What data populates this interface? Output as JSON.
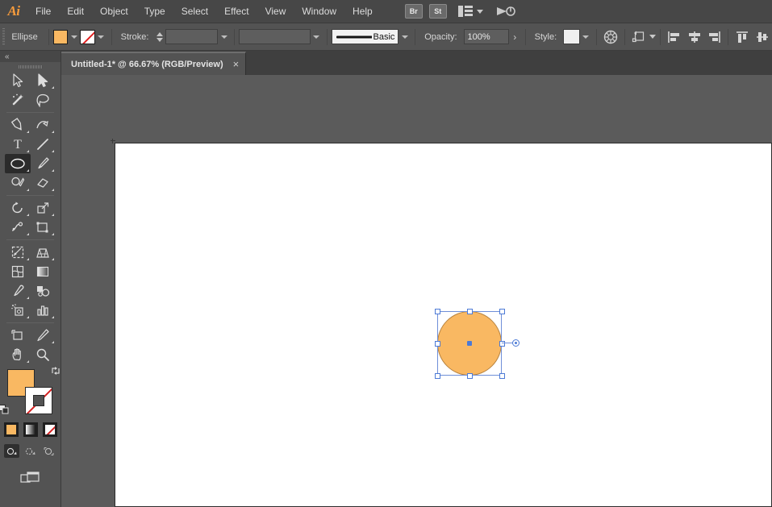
{
  "app": {
    "name": "Adobe Illustrator",
    "logo_text": "Ai"
  },
  "menubar": {
    "items": [
      {
        "label": "File"
      },
      {
        "label": "Edit"
      },
      {
        "label": "Object"
      },
      {
        "label": "Type"
      },
      {
        "label": "Select"
      },
      {
        "label": "Effect"
      },
      {
        "label": "View"
      },
      {
        "label": "Window"
      },
      {
        "label": "Help"
      }
    ],
    "bridge_label": "Br",
    "stock_label": "St",
    "arrange_documents_icon": "arrange-documents-icon",
    "workspace_switcher_icon": "workspace-switcher-icon"
  },
  "controlbar": {
    "selection_label": "Ellipse",
    "fill_label": "Fill",
    "fill_color": "#F9B862",
    "stroke_label": "Stroke:",
    "stroke_color": "none",
    "stroke_weight": "",
    "stroke_profile": "",
    "brush_definition": "Basic",
    "opacity_label": "Opacity:",
    "opacity_value": "100%",
    "style_label": "Style:",
    "style_swatch_color": "#F0F0F0",
    "recolor_artwork_icon": "recolor-artwork-icon",
    "transform_icon": "transform-icon",
    "align_buttons": [
      {
        "name": "align-left-icon"
      },
      {
        "name": "align-horizontal-center-icon"
      },
      {
        "name": "align-right-icon"
      },
      {
        "name": "align-top-icon"
      },
      {
        "name": "align-vertical-center-icon"
      }
    ]
  },
  "tabbar": {
    "document_tab": {
      "title": "Untitled-1* @ 66.67% (RGB/Preview)",
      "close_label": "×"
    }
  },
  "toolpanel": {
    "collapse_label": "«",
    "tools": [
      {
        "name": "selection-tool",
        "label": "Selection Tool",
        "selected": false,
        "has_flyout": false
      },
      {
        "name": "direct-selection-tool",
        "label": "Direct Selection Tool",
        "selected": false,
        "has_flyout": true
      },
      {
        "name": "magic-wand-tool",
        "label": "Magic Wand Tool",
        "selected": false,
        "has_flyout": false
      },
      {
        "name": "lasso-tool",
        "label": "Lasso Tool",
        "selected": false,
        "has_flyout": false
      },
      {
        "name": "pen-tool",
        "label": "Pen Tool",
        "selected": false,
        "has_flyout": true
      },
      {
        "name": "curvature-tool",
        "label": "Curvature Tool",
        "selected": false,
        "has_flyout": true
      },
      {
        "name": "type-tool",
        "label": "Type Tool",
        "selected": false,
        "has_flyout": true
      },
      {
        "name": "line-segment-tool",
        "label": "Line Segment Tool",
        "selected": false,
        "has_flyout": true
      },
      {
        "name": "ellipse-tool",
        "label": "Ellipse Tool",
        "selected": true,
        "has_flyout": true
      },
      {
        "name": "paintbrush-tool",
        "label": "Paintbrush Tool",
        "selected": false,
        "has_flyout": true
      },
      {
        "name": "shaper-tool",
        "label": "Shaper Tool",
        "selected": false,
        "has_flyout": true
      },
      {
        "name": "eraser-tool",
        "label": "Eraser Tool",
        "selected": false,
        "has_flyout": true
      },
      {
        "name": "rotate-tool",
        "label": "Rotate Tool",
        "selected": false,
        "has_flyout": true
      },
      {
        "name": "scale-tool",
        "label": "Scale Tool",
        "selected": false,
        "has_flyout": true
      },
      {
        "name": "width-tool",
        "label": "Width Tool",
        "selected": false,
        "has_flyout": true
      },
      {
        "name": "free-transform-tool",
        "label": "Free Transform Tool",
        "selected": false,
        "has_flyout": true
      },
      {
        "name": "shape-builder-tool",
        "label": "Shape Builder Tool",
        "selected": false,
        "has_flyout": true
      },
      {
        "name": "perspective-grid-tool",
        "label": "Perspective Grid Tool",
        "selected": false,
        "has_flyout": true
      },
      {
        "name": "mesh-tool",
        "label": "Mesh Tool",
        "selected": false,
        "has_flyout": false
      },
      {
        "name": "gradient-tool",
        "label": "Gradient Tool",
        "selected": false,
        "has_flyout": false
      },
      {
        "name": "eyedropper-tool",
        "label": "Eyedropper Tool",
        "selected": false,
        "has_flyout": true
      },
      {
        "name": "blend-tool",
        "label": "Blend Tool",
        "selected": false,
        "has_flyout": false
      },
      {
        "name": "symbol-sprayer-tool",
        "label": "Symbol Sprayer Tool",
        "selected": false,
        "has_flyout": true
      },
      {
        "name": "column-graph-tool",
        "label": "Column Graph Tool",
        "selected": false,
        "has_flyout": true
      },
      {
        "name": "artboard-tool",
        "label": "Artboard Tool",
        "selected": false,
        "has_flyout": false
      },
      {
        "name": "slice-tool",
        "label": "Slice Tool",
        "selected": false,
        "has_flyout": true
      },
      {
        "name": "hand-tool",
        "label": "Hand Tool",
        "selected": false,
        "has_flyout": true
      },
      {
        "name": "zoom-tool",
        "label": "Zoom Tool",
        "selected": false,
        "has_flyout": false
      }
    ],
    "color_controls": {
      "fill_color": "#F9B862",
      "stroke_color": "none",
      "swap_icon": "swap-fill-stroke-icon",
      "default_icon": "default-fill-stroke-icon",
      "mode_buttons": [
        {
          "name": "color-button",
          "label": "Color"
        },
        {
          "name": "gradient-button",
          "label": "Gradient"
        },
        {
          "name": "none-button",
          "label": "None"
        }
      ],
      "draw_modes": [
        {
          "name": "draw-normal-button",
          "label": "Draw Normal",
          "active": true
        },
        {
          "name": "draw-behind-button",
          "label": "Draw Behind",
          "active": false
        },
        {
          "name": "draw-inside-button",
          "label": "Draw Inside",
          "active": false
        }
      ],
      "screen_mode": {
        "name": "change-screen-mode-button",
        "label": "Change Screen Mode"
      }
    }
  },
  "canvas": {
    "background_color": "#5B5B5B",
    "artboard_color": "#FFFFFF",
    "object": {
      "type": "ellipse",
      "fill_color": "#F9B862",
      "selected": true,
      "selection_color": "#4C7AD6"
    }
  }
}
